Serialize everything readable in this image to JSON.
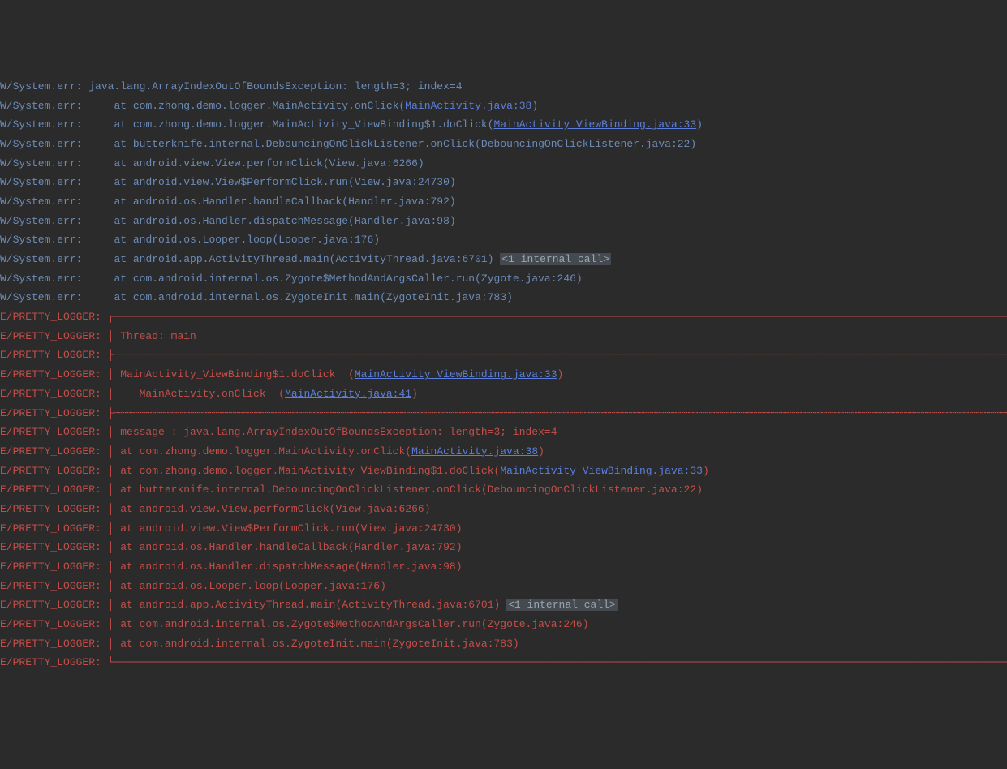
{
  "colors": {
    "bg": "#2b2b2b",
    "warn": "#6b8bb8",
    "err": "#c34e49",
    "link": "#5b7edb",
    "internal_bg": "#444a4f"
  },
  "lines": [
    {
      "level": "W",
      "tag": "W/System.err: ",
      "parts": [
        {
          "t": "text",
          "v": "java.lang.ArrayIndexOutOfBoundsException: length=3; index=4"
        }
      ]
    },
    {
      "level": "W",
      "tag": "W/System.err:     ",
      "parts": [
        {
          "t": "text",
          "v": "at com.zhong.demo.logger.MainActivity.onClick("
        },
        {
          "t": "link",
          "v": "MainActivity.java:38"
        },
        {
          "t": "text",
          "v": ")"
        }
      ]
    },
    {
      "level": "W",
      "tag": "W/System.err:     ",
      "parts": [
        {
          "t": "text",
          "v": "at com.zhong.demo.logger.MainActivity_ViewBinding$1.doClick("
        },
        {
          "t": "link",
          "v": "MainActivity_ViewBinding.java:33"
        },
        {
          "t": "text",
          "v": ")"
        }
      ]
    },
    {
      "level": "W",
      "tag": "W/System.err:     ",
      "parts": [
        {
          "t": "text",
          "v": "at butterknife.internal.DebouncingOnClickListener.onClick(DebouncingOnClickListener.java:22)"
        }
      ]
    },
    {
      "level": "W",
      "tag": "W/System.err:     ",
      "parts": [
        {
          "t": "text",
          "v": "at android.view.View.performClick(View.java:6266)"
        }
      ]
    },
    {
      "level": "W",
      "tag": "W/System.err:     ",
      "parts": [
        {
          "t": "text",
          "v": "at android.view.View$PerformClick.run(View.java:24730)"
        }
      ]
    },
    {
      "level": "W",
      "tag": "W/System.err:     ",
      "parts": [
        {
          "t": "text",
          "v": "at android.os.Handler.handleCallback(Handler.java:792)"
        }
      ]
    },
    {
      "level": "W",
      "tag": "W/System.err:     ",
      "parts": [
        {
          "t": "text",
          "v": "at android.os.Handler.dispatchMessage(Handler.java:98)"
        }
      ]
    },
    {
      "level": "W",
      "tag": "W/System.err:     ",
      "parts": [
        {
          "t": "text",
          "v": "at android.os.Looper.loop(Looper.java:176)"
        }
      ]
    },
    {
      "level": "W",
      "tag": "W/System.err:     ",
      "parts": [
        {
          "t": "text",
          "v": "at android.app.ActivityThread.main(ActivityThread.java:6701) "
        },
        {
          "t": "internal",
          "v": "<1 internal call>"
        }
      ]
    },
    {
      "level": "W",
      "tag": "W/System.err:     ",
      "parts": [
        {
          "t": "text",
          "v": "at com.android.internal.os.Zygote$MethodAndArgsCaller.run(Zygote.java:246)"
        }
      ]
    },
    {
      "level": "W",
      "tag": "W/System.err:     ",
      "parts": [
        {
          "t": "text",
          "v": "at com.android.internal.os.ZygoteInit.main(ZygoteInit.java:783)"
        }
      ]
    },
    {
      "level": "E",
      "tag": "E/PRETTY_LOGGER: ",
      "parts": [
        {
          "t": "text",
          "v": "┌────────────────────────────────────────────────────────────────────────────────────────────────────────────────────────────────────────────────────────────────────────"
        }
      ]
    },
    {
      "level": "E",
      "tag": "E/PRETTY_LOGGER: ",
      "parts": [
        {
          "t": "text",
          "v": "│ Thread: main"
        }
      ]
    },
    {
      "level": "E",
      "tag": "E/PRETTY_LOGGER: ",
      "parts": [
        {
          "t": "text",
          "v": "├┄┄┄┄┄┄┄┄┄┄┄┄┄┄┄┄┄┄┄┄┄┄┄┄┄┄┄┄┄┄┄┄┄┄┄┄┄┄┄┄┄┄┄┄┄┄┄┄┄┄┄┄┄┄┄┄┄┄┄┄┄┄┄┄┄┄┄┄┄┄┄┄┄┄┄┄┄┄┄┄┄┄┄┄┄┄┄┄┄┄┄┄┄┄┄┄┄┄┄┄┄┄┄┄┄┄┄┄┄┄┄┄┄┄┄┄┄┄┄┄┄┄┄┄┄┄┄┄┄┄┄┄┄┄┄┄┄┄┄┄┄┄┄┄┄┄┄┄┄┄┄┄┄┄┄┄┄┄┄┄┄┄┄┄┄┄┄┄┄┄┄┄"
        }
      ]
    },
    {
      "level": "E",
      "tag": "E/PRETTY_LOGGER: ",
      "parts": [
        {
          "t": "text",
          "v": "│ MainActivity_ViewBinding$1.doClick  ("
        },
        {
          "t": "link",
          "v": "MainActivity_ViewBinding.java:33"
        },
        {
          "t": "text",
          "v": ")"
        }
      ]
    },
    {
      "level": "E",
      "tag": "E/PRETTY_LOGGER: ",
      "parts": [
        {
          "t": "text",
          "v": "│    MainActivity.onClick  ("
        },
        {
          "t": "link",
          "v": "MainActivity.java:41"
        },
        {
          "t": "text",
          "v": ")"
        }
      ]
    },
    {
      "level": "E",
      "tag": "E/PRETTY_LOGGER: ",
      "parts": [
        {
          "t": "text",
          "v": "├┄┄┄┄┄┄┄┄┄┄┄┄┄┄┄┄┄┄┄┄┄┄┄┄┄┄┄┄┄┄┄┄┄┄┄┄┄┄┄┄┄┄┄┄┄┄┄┄┄┄┄┄┄┄┄┄┄┄┄┄┄┄┄┄┄┄┄┄┄┄┄┄┄┄┄┄┄┄┄┄┄┄┄┄┄┄┄┄┄┄┄┄┄┄┄┄┄┄┄┄┄┄┄┄┄┄┄┄┄┄┄┄┄┄┄┄┄┄┄┄┄┄┄┄┄┄┄┄┄┄┄┄┄┄┄┄┄┄┄┄┄┄┄┄┄┄┄┄┄┄┄┄┄┄┄┄┄┄┄┄┄┄┄┄┄┄┄┄┄┄┄┄"
        }
      ]
    },
    {
      "level": "E",
      "tag": "E/PRETTY_LOGGER: ",
      "parts": [
        {
          "t": "text",
          "v": "│ message : java.lang.ArrayIndexOutOfBoundsException: length=3; index=4"
        }
      ]
    },
    {
      "level": "E",
      "tag": "E/PRETTY_LOGGER: ",
      "parts": [
        {
          "t": "text",
          "v": "│ at com.zhong.demo.logger.MainActivity.onClick("
        },
        {
          "t": "link",
          "v": "MainActivity.java:38"
        },
        {
          "t": "text",
          "v": ")"
        }
      ]
    },
    {
      "level": "E",
      "tag": "E/PRETTY_LOGGER: ",
      "parts": [
        {
          "t": "text",
          "v": "│ at com.zhong.demo.logger.MainActivity_ViewBinding$1.doClick("
        },
        {
          "t": "link",
          "v": "MainActivity_ViewBinding.java:33"
        },
        {
          "t": "text",
          "v": ")"
        }
      ]
    },
    {
      "level": "E",
      "tag": "E/PRETTY_LOGGER: ",
      "parts": [
        {
          "t": "text",
          "v": "│ at butterknife.internal.DebouncingOnClickListener.onClick(DebouncingOnClickListener.java:22)"
        }
      ]
    },
    {
      "level": "E",
      "tag": "E/PRETTY_LOGGER: ",
      "parts": [
        {
          "t": "text",
          "v": "│ at android.view.View.performClick(View.java:6266)"
        }
      ]
    },
    {
      "level": "E",
      "tag": "E/PRETTY_LOGGER: ",
      "parts": [
        {
          "t": "text",
          "v": "│ at android.view.View$PerformClick.run(View.java:24730)"
        }
      ]
    },
    {
      "level": "E",
      "tag": "E/PRETTY_LOGGER: ",
      "parts": [
        {
          "t": "text",
          "v": "│ at android.os.Handler.handleCallback(Handler.java:792)"
        }
      ]
    },
    {
      "level": "E",
      "tag": "E/PRETTY_LOGGER: ",
      "parts": [
        {
          "t": "text",
          "v": "│ at android.os.Handler.dispatchMessage(Handler.java:98)"
        }
      ]
    },
    {
      "level": "E",
      "tag": "E/PRETTY_LOGGER: ",
      "parts": [
        {
          "t": "text",
          "v": "│ at android.os.Looper.loop(Looper.java:176)"
        }
      ]
    },
    {
      "level": "E",
      "tag": "E/PRETTY_LOGGER: ",
      "parts": [
        {
          "t": "text",
          "v": "│ at android.app.ActivityThread.main(ActivityThread.java:6701) "
        },
        {
          "t": "internal",
          "v": "<1 internal call>"
        }
      ]
    },
    {
      "level": "E",
      "tag": "E/PRETTY_LOGGER: ",
      "parts": [
        {
          "t": "text",
          "v": "│ at com.android.internal.os.Zygote$MethodAndArgsCaller.run(Zygote.java:246)"
        }
      ]
    },
    {
      "level": "E",
      "tag": "E/PRETTY_LOGGER: ",
      "parts": [
        {
          "t": "text",
          "v": "│ at com.android.internal.os.ZygoteInit.main(ZygoteInit.java:783)"
        }
      ]
    },
    {
      "level": "E",
      "tag": "E/PRETTY_LOGGER: ",
      "parts": [
        {
          "t": "text",
          "v": "└────────────────────────────────────────────────────────────────────────────────────────────────────────────────────────────────────────────────────────────────────────"
        }
      ]
    }
  ]
}
